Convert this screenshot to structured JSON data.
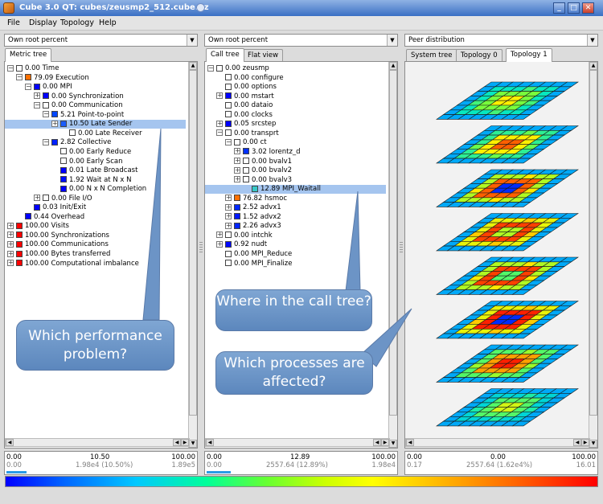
{
  "window": {
    "title": "Cube 3.0 QT: cubes/zeusmp2_512.cube.gz",
    "min_label": "_",
    "max_label": "□",
    "close_label": "✕"
  },
  "menu": [
    "File",
    "Display",
    "Topology",
    "Help"
  ],
  "left": {
    "combo": "Own root percent",
    "tabs": [
      "Metric tree"
    ],
    "rows": [
      {
        "text": "0.00 Time",
        "color": "#ffffff"
      },
      {
        "text": "79.09 Execution",
        "color": "#ff7000"
      },
      {
        "text": "0.00 MPI",
        "color": "#0000ff"
      },
      {
        "text": "0.00 Synchronization",
        "color": "#0000ff"
      },
      {
        "text": "0.00 Communication",
        "color": "#ffffff"
      },
      {
        "text": "5.21 Point-to-point",
        "color": "#0046ff"
      },
      {
        "text": "10.50 Late Sender",
        "color": "#1a5cff"
      },
      {
        "text": "0.00 Late Receiver",
        "color": "#ffffff"
      },
      {
        "text": "2.82 Collective",
        "color": "#0020ff"
      },
      {
        "text": "0.00 Early Reduce",
        "color": "#ffffff"
      },
      {
        "text": "0.00 Early Scan",
        "color": "#ffffff"
      },
      {
        "text": "0.01 Late Broadcast",
        "color": "#0000ff"
      },
      {
        "text": "1.92 Wait at N x N",
        "color": "#0010ff"
      },
      {
        "text": "0.00 N x N Completion",
        "color": "#0000ff"
      },
      {
        "text": "0.00 File I/O",
        "color": "#ffffff"
      },
      {
        "text": "0.03 Init/Exit",
        "color": "#0000ff"
      },
      {
        "text": "0.44 Overhead",
        "color": "#0000ff"
      },
      {
        "text": "100.00 Visits",
        "color": "#ff0000"
      },
      {
        "text": "100.00 Synchronizations",
        "color": "#ff0000"
      },
      {
        "text": "100.00 Communications",
        "color": "#ff0000"
      },
      {
        "text": "100.00 Bytes transferred",
        "color": "#ff0000"
      },
      {
        "text": "100.00 Computational imbalance",
        "color": "#ff0000"
      }
    ],
    "stats": {
      "min": "0.00",
      "value": "10.50",
      "max": "100.00",
      "sub_min": "0.00",
      "sub_value": "1.98e4 (10.50%)",
      "sub_max": "1.89e5"
    }
  },
  "middle": {
    "combo": "Own root percent",
    "tabs": [
      "Call tree",
      "Flat view"
    ],
    "rows": [
      {
        "text": "0.00 zeusmp",
        "color": "#ffffff"
      },
      {
        "text": "0.00 configure",
        "color": "#ffffff"
      },
      {
        "text": "0.00 options",
        "color": "#ffffff"
      },
      {
        "text": "0.00 mstart",
        "color": "#0000ff"
      },
      {
        "text": "0.00 dataio",
        "color": "#ffffff"
      },
      {
        "text": "0.00 clocks",
        "color": "#ffffff"
      },
      {
        "text": "0.05 srcstep",
        "color": "#0000ff"
      },
      {
        "text": "0.00 transprt",
        "color": "#ffffff"
      },
      {
        "text": "0.00 ct",
        "color": "#ffffff"
      },
      {
        "text": "3.02 lorentz_d",
        "color": "#0030ff"
      },
      {
        "text": "0.00 bvalv1",
        "color": "#ffffff"
      },
      {
        "text": "0.00 bvalv2",
        "color": "#ffffff"
      },
      {
        "text": "0.00 bvalv3",
        "color": "#ffffff"
      },
      {
        "text": "12.89 MPI_Waitall",
        "color": "#36c8c8"
      },
      {
        "text": "76.82 hsmoc",
        "color": "#ff7000"
      },
      {
        "text": "2.52 advx1",
        "color": "#0028ff"
      },
      {
        "text": "1.52 advx2",
        "color": "#0018ff"
      },
      {
        "text": "2.26 advx3",
        "color": "#0024ff"
      },
      {
        "text": "0.00 intchk",
        "color": "#ffffff"
      },
      {
        "text": "0.92 nudt",
        "color": "#0008ff"
      },
      {
        "text": "0.00 MPI_Reduce",
        "color": "#ffffff"
      },
      {
        "text": "0.00 MPI_Finalize",
        "color": "#ffffff"
      }
    ],
    "stats": {
      "min": "0.00",
      "value": "12.89",
      "max": "100.00",
      "sub_min": "0.00",
      "sub_value": "2557.64 (12.89%)",
      "sub_max": "1.98e4"
    }
  },
  "right": {
    "combo": "Peer distribution",
    "tabs": [
      "System tree",
      "Topology 0",
      "Topology 1"
    ],
    "stats": {
      "min": "0.00",
      "value": "0.00",
      "max": "100.00",
      "sub_min": "0.17",
      "sub_value": "2557.64 (1.62e4%)",
      "sub_max": "16.01"
    }
  },
  "callouts": {
    "performance": "Which performance problem?",
    "calltree": "Where in the call tree?",
    "processes": "Which processes are affected?"
  },
  "colors": {
    "spectrum": [
      "#0000ff",
      "#00c8ff",
      "#66ff33",
      "#ffff00",
      "#ff6600",
      "#ff0000"
    ],
    "selection": "#a5c5ef",
    "title_bar": "#3a6fc4"
  }
}
